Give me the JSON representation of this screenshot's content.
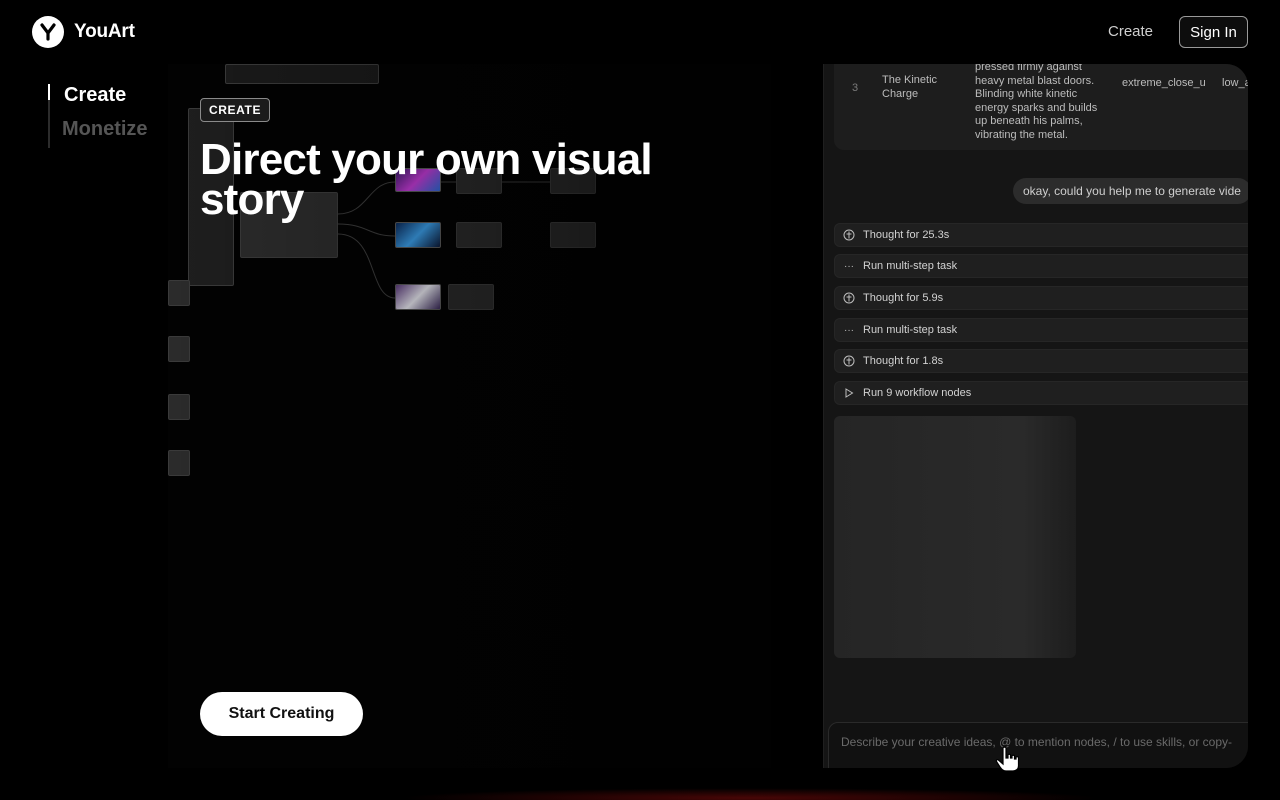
{
  "header": {
    "brand": "YouArt",
    "nav_create": "Create",
    "sign_in": "Sign In"
  },
  "rail": {
    "items": [
      "Create",
      "Monetize"
    ],
    "active_index": 0
  },
  "hero": {
    "badge": "CREATE",
    "headline": "Direct your own visual story",
    "cta": "Start Creating"
  },
  "chat": {
    "table_row": {
      "index": "3",
      "title": "The Kinetic Charge",
      "description": "pressed firmly against heavy metal blast doors. Blinding white kinetic energy sparks and builds up beneath his palms, vibrating the metal.",
      "shot": "extreme_close_up",
      "angle": "low_a"
    },
    "user_message": "okay, could you help me to generate vide",
    "steps": [
      {
        "icon": "brain-icon",
        "label": "Thought for 25.3s"
      },
      {
        "icon": "dots-icon",
        "label": "Run multi-step task"
      },
      {
        "icon": "brain-icon",
        "label": "Thought for 5.9s"
      },
      {
        "icon": "dots-icon",
        "label": "Run multi-step task"
      },
      {
        "icon": "brain-icon",
        "label": "Thought for 1.8s"
      },
      {
        "icon": "play-icon",
        "label": "Run 9 workflow nodes"
      }
    ],
    "input_placeholder": "Describe your creative ideas, @ to mention nodes, / to use skills, or copy-"
  },
  "colors": {
    "background": "#000000",
    "panel": "#151515",
    "accent": "#ffffff"
  }
}
